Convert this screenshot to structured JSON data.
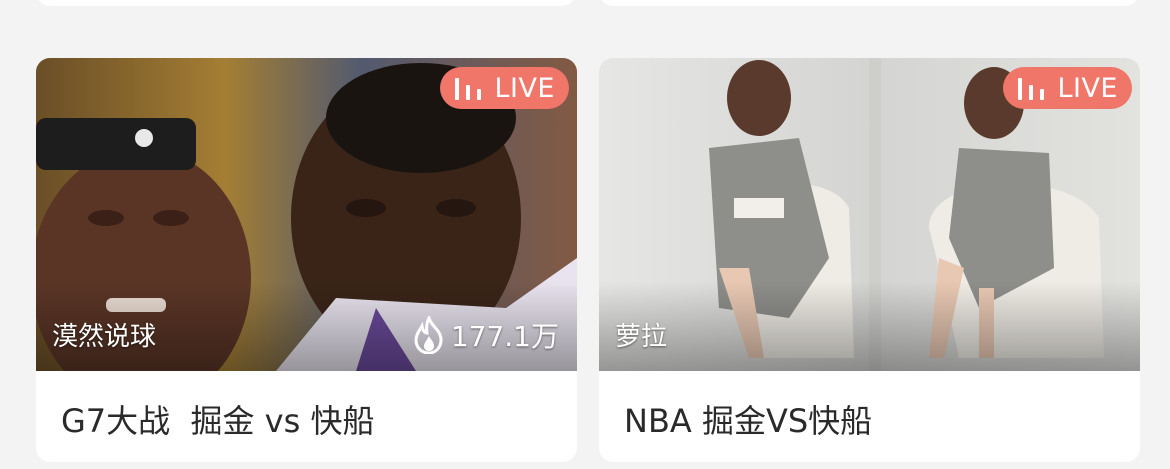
{
  "feed": {
    "cards": [
      {
        "live_label": "LIVE",
        "streamer": "漠然说球",
        "heat": "177.1万",
        "title": "G7大战  掘金 vs 快船"
      },
      {
        "live_label": "LIVE",
        "streamer": "萝拉",
        "title": "NBA 掘金VS快船"
      }
    ]
  },
  "colors": {
    "badge": "#f0766a",
    "page_bg": "#f3f3f3",
    "card_bg": "#ffffff",
    "title_text": "#2a2a2a"
  },
  "icons": [
    "live-bars-icon",
    "flame-icon"
  ]
}
